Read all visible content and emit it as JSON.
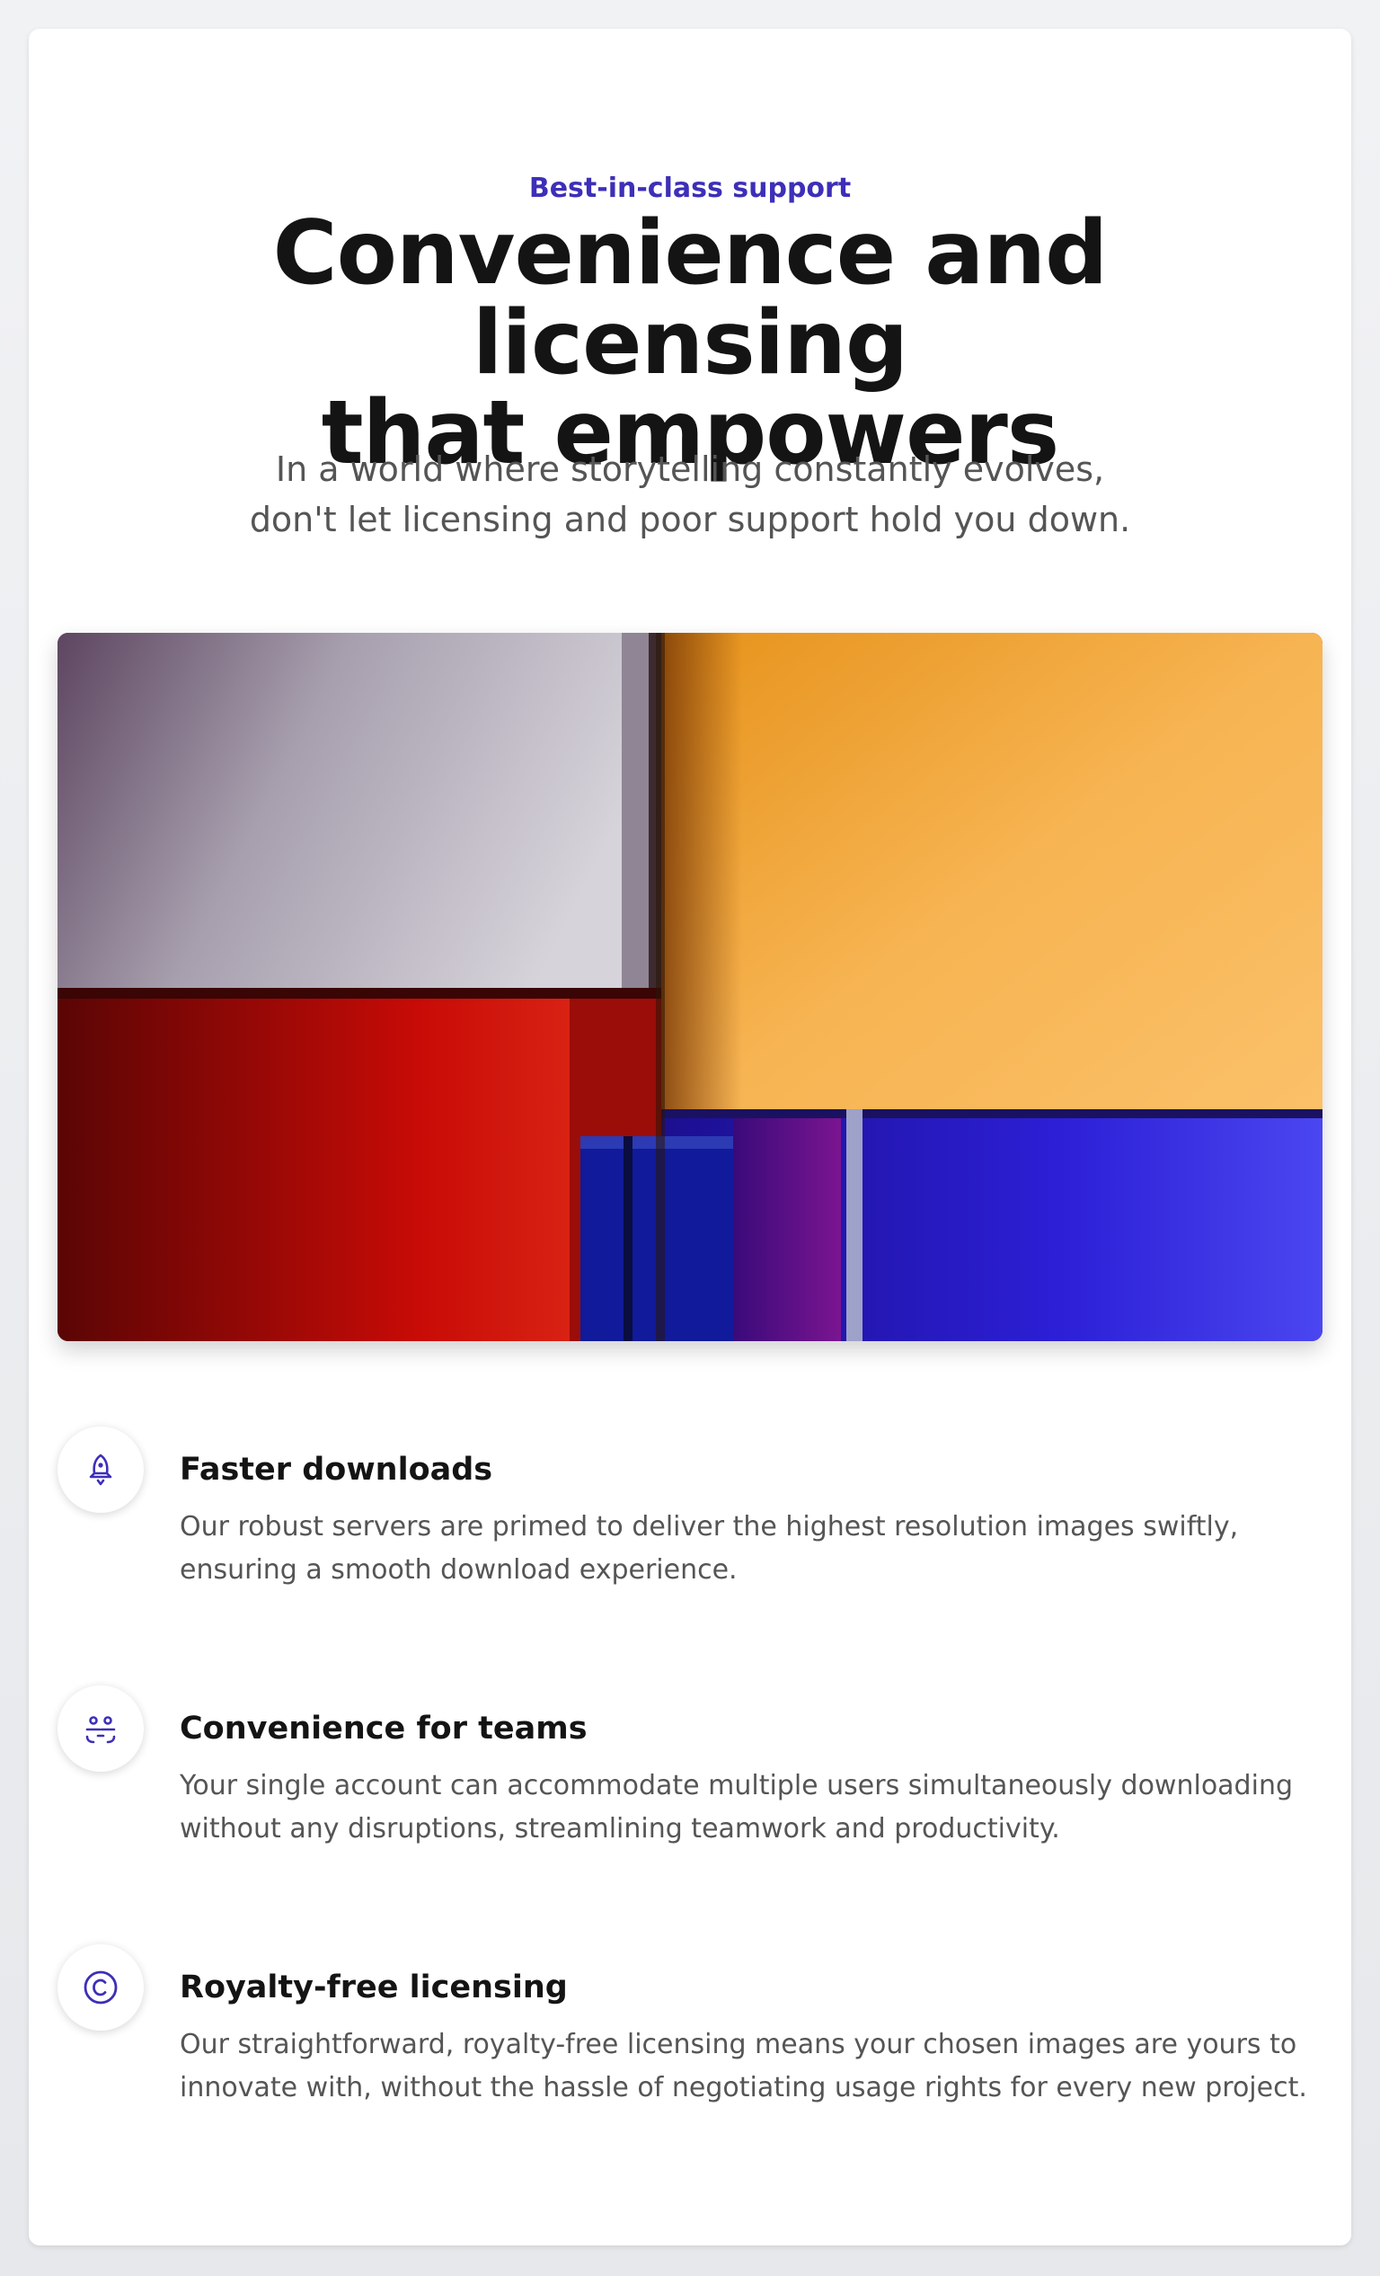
{
  "section": {
    "eyebrow": "Best-in-class support",
    "headline_line1": "Convenience and licensing",
    "headline_line2": "that empowers",
    "subtitle_line1": "In a world where storytelling constantly evolves,",
    "subtitle_line2": "don't let licensing and poor support hold you down."
  },
  "hero_image": {
    "description_icon": "abstract-colored-blocks-image",
    "colors": {
      "lavender": "#b9b2c3",
      "red": "#c41209",
      "orange": "#f6b14d",
      "blue": "#2a1fd0"
    }
  },
  "features": [
    {
      "icon": "rocket-icon",
      "title": "Faster downloads",
      "body_line1": "Our robust servers are primed to deliver the highest resolution images swiftly,",
      "body_line2": "ensuring a smooth download experience."
    },
    {
      "icon": "team-users-icon",
      "title": "Convenience for teams",
      "body_line1": "Your single account can accommodate multiple users simultaneously downloading",
      "body_line2": "without any disruptions, streamlining teamwork and productivity."
    },
    {
      "icon": "copyright-icon",
      "title": "Royalty-free licensing",
      "body_line1": "Our straightforward, royalty-free licensing means your chosen images are yours to",
      "body_line2": "innovate with, without the hassle of negotiating usage rights for every new project."
    }
  ],
  "theme": {
    "accent": "#3d2fb8",
    "heading": "#141414",
    "body_text": "#555555",
    "card_background": "#ffffff"
  }
}
